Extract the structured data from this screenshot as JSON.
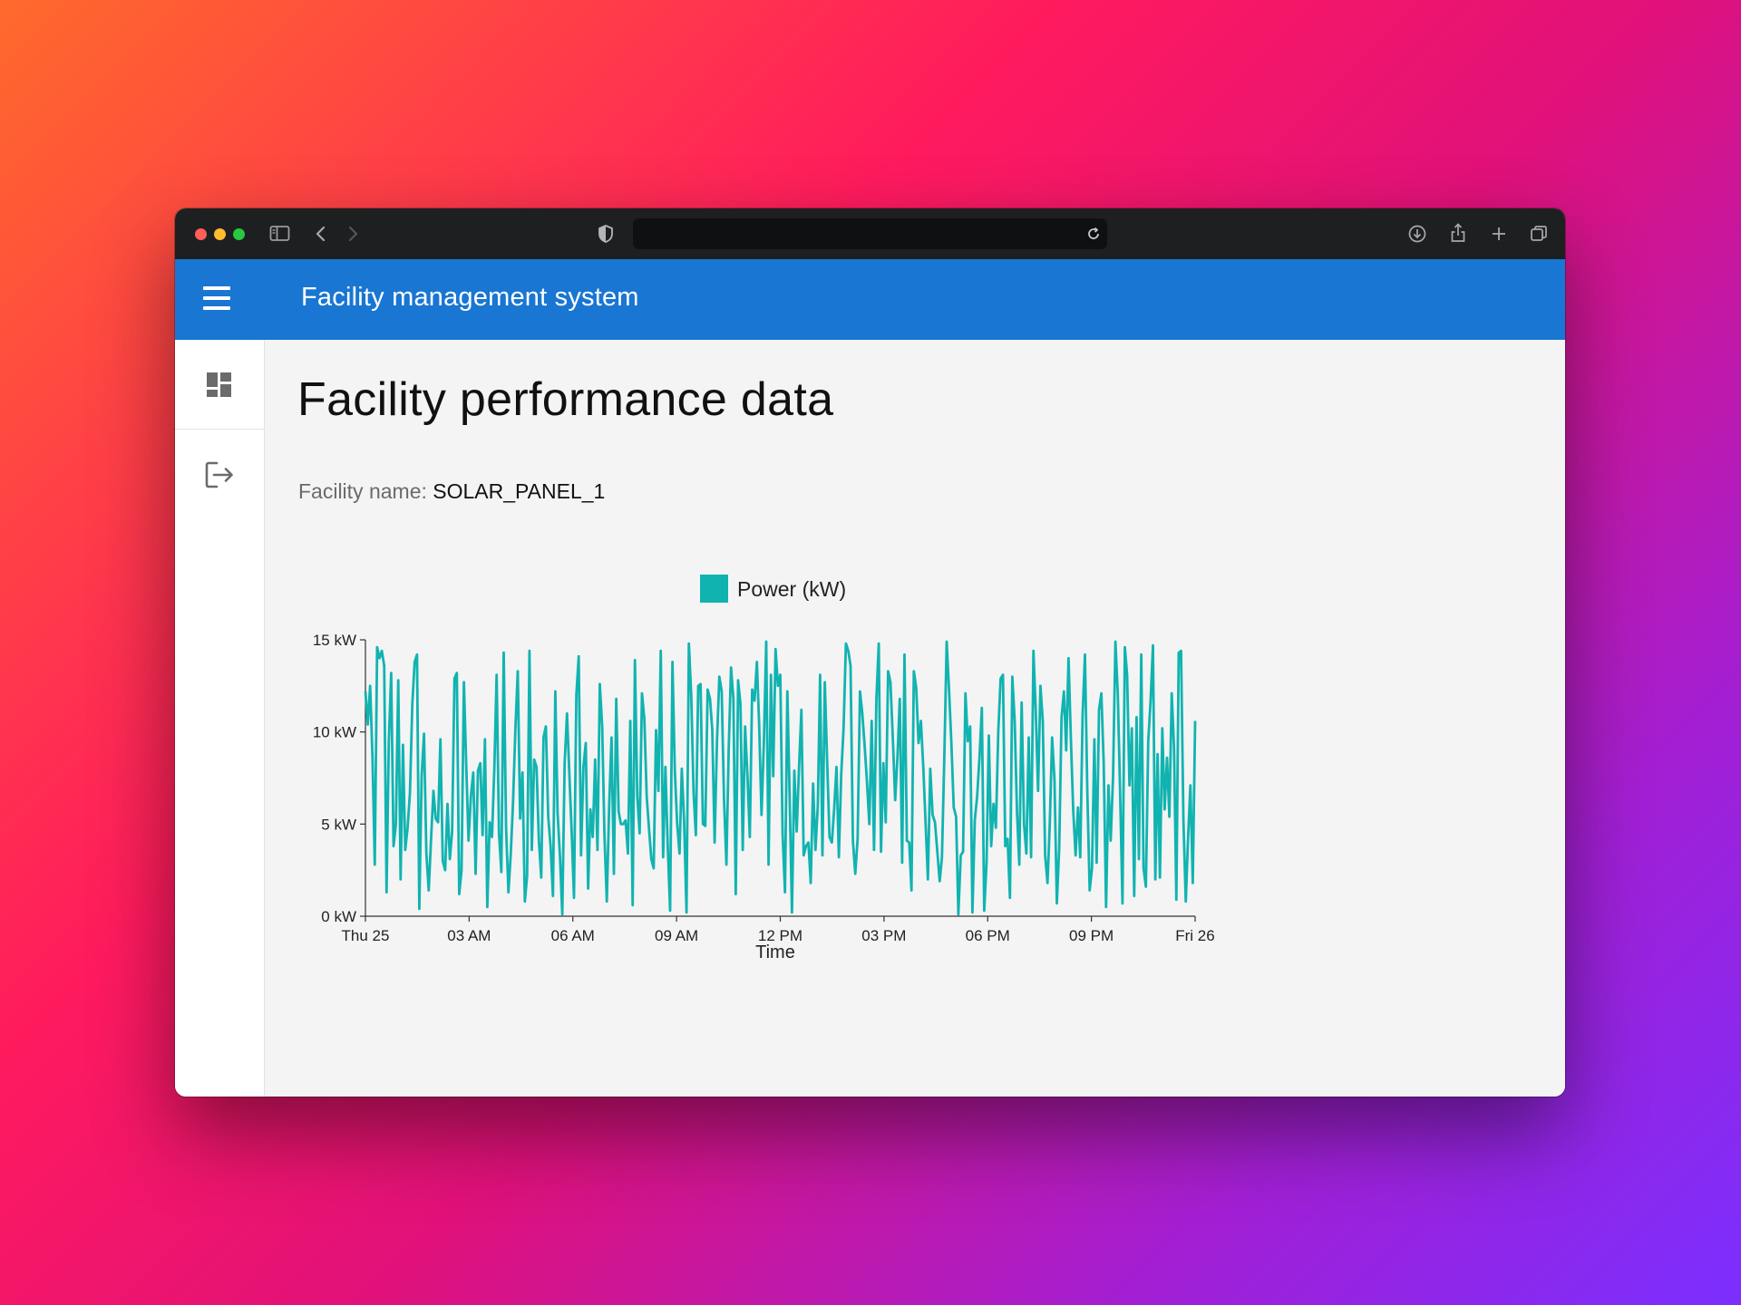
{
  "app": {
    "title": "Facility management system",
    "colors": {
      "appbar": "#1976d2",
      "titlebar": "#1e1f21",
      "series": "#11b3b0"
    }
  },
  "browser": {
    "icons": [
      "sidebar-toggle-icon",
      "back-icon",
      "forward-icon",
      "shield-icon",
      "reload-icon",
      "download-icon",
      "share-icon",
      "new-tab-icon",
      "tabs-overview-icon"
    ]
  },
  "sidebar": {
    "items": [
      {
        "name": "dashboard",
        "icon": "dashboard-icon"
      },
      {
        "name": "logout",
        "icon": "logout-icon"
      }
    ]
  },
  "page": {
    "title": "Facility performance data",
    "facility_label": "Facility name:",
    "facility_value": "SOLAR_PANEL_1"
  },
  "chart_data": {
    "type": "line",
    "legend": "Power (kW)",
    "xlabel": "Time",
    "ylabel": "",
    "x_ticks": [
      "Thu 25",
      "03 AM",
      "06 AM",
      "09 AM",
      "12 PM",
      "03 PM",
      "06 PM",
      "09 PM",
      "Fri 26"
    ],
    "y_ticks": [
      "0 kW",
      "5 kW",
      "10 kW",
      "15 kW"
    ],
    "ylim": [
      0,
      15
    ],
    "xlim": [
      "Thu 25 00:00",
      "Fri 26 00:00"
    ],
    "grid": false,
    "legend_position": "top-center",
    "series": [
      {
        "name": "Power (kW)",
        "values": [
          12.2,
          10.4,
          12.5,
          8.6,
          2.8,
          14.6,
          14.0,
          14.4,
          13.6,
          1.3,
          9.5,
          13.2,
          3.8,
          5.0,
          12.8,
          2.0,
          9.3,
          3.6,
          4.8,
          6.7,
          11.5,
          13.8,
          14.2,
          0.4,
          7.6,
          9.9,
          3.4,
          1.4,
          4.2,
          6.8,
          5.3,
          5.1,
          9.6,
          3.0,
          2.5,
          6.1,
          3.1,
          4.6,
          12.9,
          13.2,
          1.2,
          2.5,
          12.7,
          8.3,
          4.1,
          6.5,
          7.8,
          2.3,
          7.9,
          8.3,
          4.4,
          9.6,
          0.5,
          5.1,
          4.3,
          8.1,
          13.1,
          4.5,
          2.4,
          14.3,
          4.8,
          1.3,
          3.4,
          6.2,
          10.2,
          13.3,
          5.3,
          7.8,
          0.8,
          2.2,
          14.4,
          3.6,
          8.5,
          8.1,
          4.1,
          2.1,
          9.7,
          10.3,
          5.4,
          3.8,
          1.1,
          12.2,
          5.6,
          3.3,
          0.1,
          8.3,
          11.0,
          7.7,
          4.5,
          1.0,
          12.0,
          14.1,
          3.3,
          8.1,
          9.4,
          1.5,
          5.8,
          4.3,
          8.5,
          3.6,
          12.6,
          10.3,
          4.4,
          0.8,
          6.0,
          9.7,
          2.3,
          11.8,
          5.7,
          5.0,
          5.0,
          5.2,
          3.4,
          10.6,
          0.6,
          13.9,
          6.5,
          4.5,
          12.1,
          10.7,
          6.5,
          4.7,
          3.1,
          2.6,
          10.1,
          6.8,
          14.4,
          3.2,
          8.1,
          3.8,
          0.3,
          13.8,
          7.9,
          5.0,
          3.4,
          8.0,
          5.1,
          0.2,
          14.8,
          12.0,
          6.7,
          4.4,
          12.5,
          12.6,
          5.0,
          4.9,
          12.3,
          11.8,
          10.1,
          4.0,
          9.5,
          13.0,
          12.2,
          6.3,
          2.8,
          9.0,
          13.5,
          11.8,
          1.2,
          12.8,
          11.5,
          3.6,
          10.3,
          7.6,
          4.3,
          12.3,
          11.7,
          13.8,
          10.4,
          5.5,
          9.4,
          14.9,
          2.8,
          13.1,
          7.6,
          14.5,
          12.5,
          13.1,
          4.4,
          1.3,
          12.2,
          6.6,
          0.2,
          7.9,
          4.6,
          8.1,
          11.2,
          3.3,
          3.8,
          4.0,
          1.8,
          7.2,
          3.6,
          6.0,
          13.1,
          3.3,
          12.7,
          8.4,
          4.3,
          4.0,
          5.8,
          8.1,
          3.2,
          7.7,
          10.2,
          14.8,
          14.4,
          13.6,
          4.1,
          2.3,
          4.2,
          12.2,
          11.0,
          9.2,
          7.3,
          5.0,
          10.6,
          3.6,
          11.8,
          14.8,
          3.5,
          8.3,
          5.1,
          13.3,
          12.7,
          9.7,
          6.3,
          8.6,
          11.8,
          2.9,
          14.2,
          4.1,
          4.0,
          1.4,
          13.3,
          12.4,
          9.4,
          10.6,
          8.1,
          5.0,
          2.0,
          8.0,
          5.5,
          5.1,
          3.5,
          1.9,
          3.2,
          8.6,
          14.9,
          12.3,
          9.4,
          5.9,
          5.4,
          0.1,
          3.3,
          3.5,
          12.1,
          9.5,
          10.3,
          0.2,
          5.2,
          6.5,
          8.6,
          11.3,
          0.3,
          2.9,
          9.8,
          3.8,
          6.1,
          4.8,
          10.0,
          12.9,
          13.1,
          3.8,
          4.2,
          1.0,
          13.0,
          10.6,
          5.6,
          2.8,
          11.6,
          5.0,
          3.4,
          9.7,
          3.2,
          14.4,
          11.2,
          6.8,
          12.5,
          10.6,
          3.3,
          1.8,
          5.0,
          9.7,
          7.4,
          0.7,
          3.7,
          10.8,
          12.2,
          9.0,
          14.0,
          9.6,
          5.7,
          3.3,
          5.9,
          3.2,
          10.9,
          14.2,
          6.8,
          1.4,
          2.6,
          9.6,
          2.9,
          11.2,
          12.1,
          8.3,
          0.5,
          7.1,
          4.1,
          7.6,
          14.9,
          12.1,
          6.7,
          0.7,
          14.6,
          13.1,
          7.1,
          10.2,
          1.1,
          10.8,
          3.1,
          14.2,
          2.6,
          1.6,
          9.5,
          11.7,
          14.7,
          2.0,
          8.8,
          2.1,
          10.2,
          5.8,
          8.6,
          5.4,
          12.1,
          9.2,
          0.9,
          14.3,
          14.4,
          5.2,
          0.8,
          4.2,
          7.1,
          1.8,
          10.6
        ]
      }
    ]
  }
}
